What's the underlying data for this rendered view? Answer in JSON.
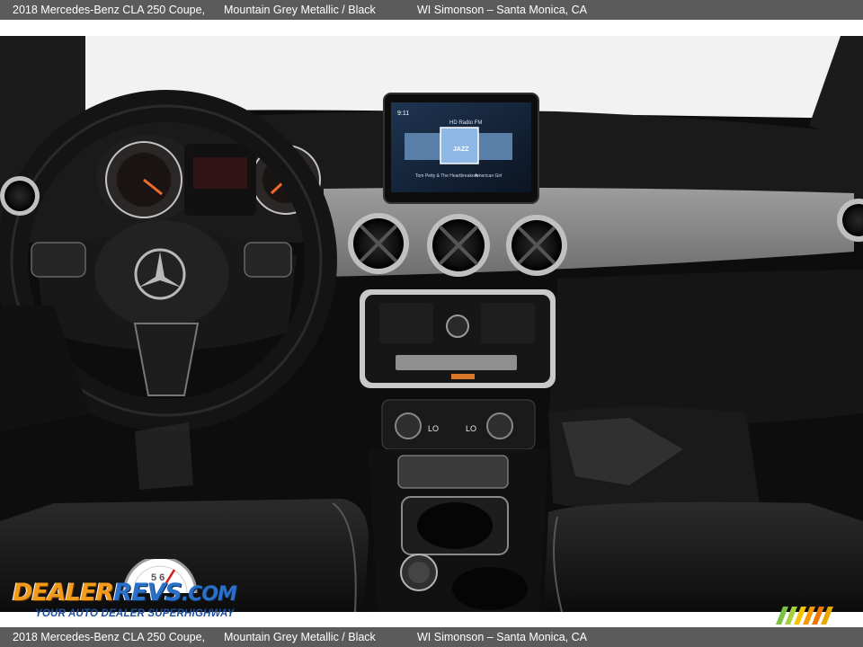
{
  "caption": {
    "title": "2018 Mercedes-Benz CLA 250 Coupe,",
    "color": "Mountain Grey Metallic / Black",
    "dealer": "WI Simonson – Santa Monica, CA"
  },
  "infotainment": {
    "time": "9:11",
    "header": "HD Radio FM",
    "selected_station": "JAZZ",
    "now_playing": "Tom Petty & The Heartbreakers",
    "song": "American Girl"
  },
  "climate": {
    "left_temp": "LO",
    "right_temp": "LO"
  },
  "watermark": {
    "logo_left": "DEALER",
    "logo_right": "REVS",
    "logo_suffix": ".COM",
    "tagline": "YOUR AUTO DEALER SUPERHIGHWAY",
    "gauge_digits": "5 6"
  },
  "colors": {
    "caption_bar": "#5b5b5b",
    "logo_orange": "#f29a1a",
    "logo_blue": "#2a70c8"
  }
}
